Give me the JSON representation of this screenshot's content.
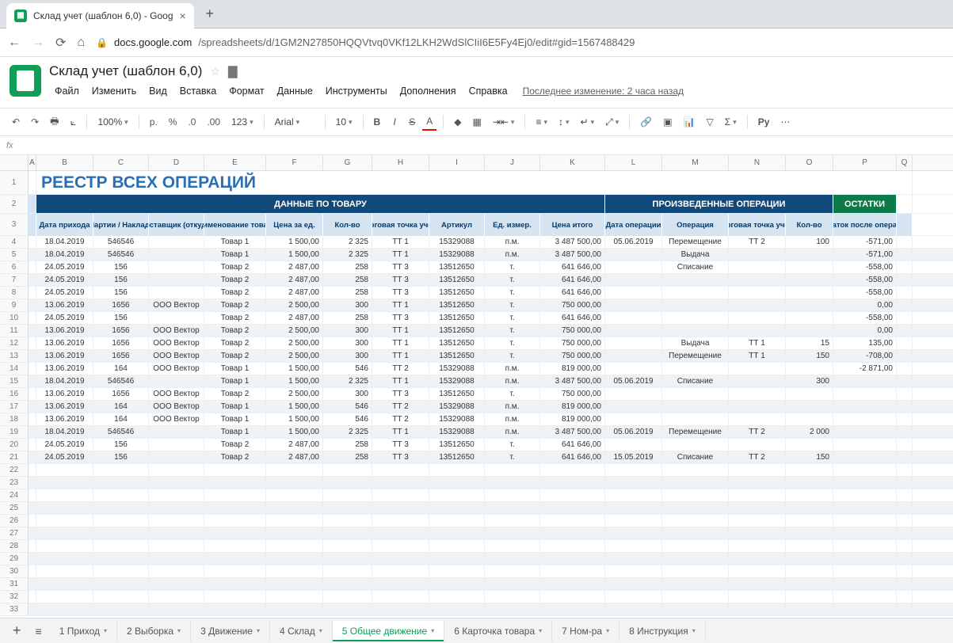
{
  "browser": {
    "tab_title": "Склад учет (шаблон 6,0) - Goog",
    "url_host": "docs.google.com",
    "url_path": "/spreadsheets/d/1GM2N27850HQQVtvq0VKf12LKH2WdSlCIiI6E5Fy4Ej0/edit#gid=1567488429"
  },
  "doc": {
    "title": "Склад учет (шаблон 6,0)",
    "menus": [
      "Файл",
      "Изменить",
      "Вид",
      "Вставка",
      "Формат",
      "Данные",
      "Инструменты",
      "Дополнения",
      "Справка"
    ],
    "last_edit": "Последнее изменение: 2 часа назад"
  },
  "toolbar": {
    "zoom": "100%",
    "currency": "р.",
    "pct": "%",
    "dec_less": ".0",
    "dec_more": ".00",
    "fmt": "123",
    "font": "Arial",
    "size": "10"
  },
  "fx": "fx",
  "cols": {
    "A": 10,
    "B": 72,
    "C": 70,
    "D": 70,
    "E": 78,
    "F": 72,
    "G": 62,
    "H": 72,
    "I": 70,
    "J": 70,
    "K": 82,
    "L": 72,
    "M": 84,
    "N": 72,
    "O": 60,
    "P": 80,
    "Q": 20
  },
  "sheet": {
    "title": "РЕЕСТР ВСЕХ ОПЕРАЦИЙ",
    "group_headers": [
      "",
      "ДАННЫЕ ПО ТОВАРУ",
      "ПРОИЗВЕДЕННЫЕ ОПЕРАЦИИ",
      "ОСТАТКИ"
    ],
    "col_labels": [
      "",
      "Дата прихода",
      "№ Партии / Накладной",
      "Поставщик (откуда)",
      "Наименование товара",
      "Цена за ед.",
      "Кол-во",
      "Торговая точка учета",
      "Артикул",
      "Ед. измер.",
      "Цена итого",
      "Дата операции",
      "Операция",
      "Торговая точка учета",
      "Кол-во",
      "Остаток после операции"
    ],
    "rows": [
      {
        "d": [
          "18.04.2019",
          "546546",
          "",
          "Товар 1",
          "1 500,00",
          "2 325",
          "ТТ 1",
          "15329088",
          "п.м.",
          "3 487 500,00",
          "05.06.2019",
          "Перемещение",
          "ТТ 2",
          "100",
          "-571,00"
        ]
      },
      {
        "d": [
          "18.04.2019",
          "546546",
          "",
          "Товар 1",
          "1 500,00",
          "2 325",
          "ТТ 1",
          "15329088",
          "п.м.",
          "3 487 500,00",
          "",
          "Выдача",
          "",
          "",
          "-571,00"
        ]
      },
      {
        "d": [
          "24.05.2019",
          "156",
          "",
          "Товар 2",
          "2 487,00",
          "258",
          "ТТ 3",
          "13512650",
          "т.",
          "641 646,00",
          "",
          "Списание",
          "",
          "",
          "-558,00"
        ]
      },
      {
        "d": [
          "24.05.2019",
          "156",
          "",
          "Товар 2",
          "2 487,00",
          "258",
          "ТТ 3",
          "13512650",
          "т.",
          "641 646,00",
          "",
          "",
          "",
          "",
          "-558,00"
        ]
      },
      {
        "d": [
          "24.05.2019",
          "156",
          "",
          "Товар 2",
          "2 487,00",
          "258",
          "ТТ 3",
          "13512650",
          "т.",
          "641 646,00",
          "",
          "",
          "",
          "",
          "-558,00"
        ]
      },
      {
        "d": [
          "13.06.2019",
          "1656",
          "ООО Вектор",
          "Товар 2",
          "2 500,00",
          "300",
          "ТТ 1",
          "13512650",
          "т.",
          "750 000,00",
          "",
          "",
          "",
          "",
          "0,00"
        ]
      },
      {
        "d": [
          "24.05.2019",
          "156",
          "",
          "Товар 2",
          "2 487,00",
          "258",
          "ТТ 3",
          "13512650",
          "т.",
          "641 646,00",
          "",
          "",
          "",
          "",
          "-558,00"
        ]
      },
      {
        "d": [
          "13.06.2019",
          "1656",
          "ООО Вектор",
          "Товар 2",
          "2 500,00",
          "300",
          "ТТ 1",
          "13512650",
          "т.",
          "750 000,00",
          "",
          "",
          "",
          "",
          "0,00"
        ]
      },
      {
        "d": [
          "13.06.2019",
          "1656",
          "ООО Вектор",
          "Товар 2",
          "2 500,00",
          "300",
          "ТТ 1",
          "13512650",
          "т.",
          "750 000,00",
          "",
          "Выдача",
          "ТТ 1",
          "15",
          "135,00"
        ]
      },
      {
        "d": [
          "13.06.2019",
          "1656",
          "ООО Вектор",
          "Товар 2",
          "2 500,00",
          "300",
          "ТТ 1",
          "13512650",
          "т.",
          "750 000,00",
          "",
          "Перемещение",
          "ТТ 1",
          "150",
          "-708,00"
        ]
      },
      {
        "d": [
          "13.06.2019",
          "164",
          "ООО Вектор",
          "Товар 1",
          "1 500,00",
          "546",
          "ТТ 2",
          "15329088",
          "п.м.",
          "819 000,00",
          "",
          "",
          "",
          "",
          "-2 871,00"
        ]
      },
      {
        "d": [
          "18.04.2019",
          "546546",
          "",
          "Товар 1",
          "1 500,00",
          "2 325",
          "ТТ 1",
          "15329088",
          "п.м.",
          "3 487 500,00",
          "05.06.2019",
          "Списание",
          "",
          "300",
          ""
        ]
      },
      {
        "d": [
          "13.06.2019",
          "1656",
          "ООО Вектор",
          "Товар 2",
          "2 500,00",
          "300",
          "ТТ 3",
          "13512650",
          "т.",
          "750 000,00",
          "",
          "",
          "",
          "",
          ""
        ]
      },
      {
        "d": [
          "13.06.2019",
          "164",
          "ООО Вектор",
          "Товар 1",
          "1 500,00",
          "546",
          "ТТ 2",
          "15329088",
          "п.м.",
          "819 000,00",
          "",
          "",
          "",
          "",
          ""
        ]
      },
      {
        "d": [
          "13.06.2019",
          "164",
          "ООО Вектор",
          "Товар 1",
          "1 500,00",
          "546",
          "ТТ 2",
          "15329088",
          "п.м.",
          "819 000,00",
          "",
          "",
          "",
          "",
          ""
        ]
      },
      {
        "d": [
          "18.04.2019",
          "546546",
          "",
          "Товар 1",
          "1 500,00",
          "2 325",
          "ТТ 1",
          "15329088",
          "п.м.",
          "3 487 500,00",
          "05.06.2019",
          "Перемещение",
          "ТТ 2",
          "2 000",
          ""
        ]
      },
      {
        "d": [
          "24.05.2019",
          "156",
          "",
          "Товар 2",
          "2 487,00",
          "258",
          "ТТ 3",
          "13512650",
          "т.",
          "641 646,00",
          "",
          "",
          "",
          "",
          ""
        ]
      },
      {
        "d": [
          "24.05.2019",
          "156",
          "",
          "Товар 2",
          "2 487,00",
          "258",
          "ТТ 3",
          "13512650",
          "т.",
          "641 646,00",
          "15.05.2019",
          "Списание",
          "ТТ 2",
          "150",
          ""
        ]
      }
    ],
    "empty_rows": 12
  },
  "tabs": [
    "1 Приход",
    "2 Выборка",
    "3 Движение",
    "4 Склад",
    "5 Общее движение",
    "6 Карточка товара",
    "7 Ном-ра",
    "8 Инструкция"
  ],
  "active_tab": 4
}
